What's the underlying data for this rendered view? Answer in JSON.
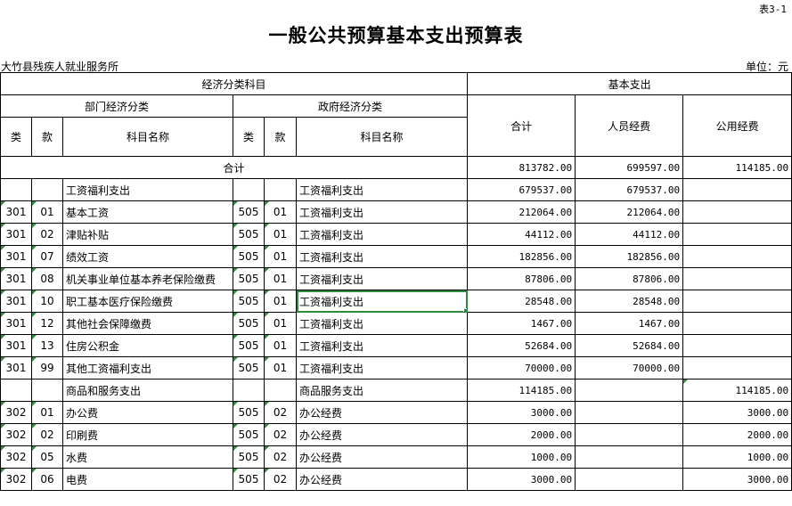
{
  "table_no": "表3-1",
  "title": "一般公共预算基本支出预算表",
  "org": "大竹县残疾人就业服务所",
  "unit": "单位：元",
  "headers": {
    "econ_class": "经济分类科目",
    "basic_exp": "基本支出",
    "dept_class": "部门经济分类",
    "gov_class": "政府经济分类",
    "total": "合计",
    "personnel": "人员经费",
    "public": "公用经费",
    "lei": "类",
    "kuan": "款",
    "name": "科目名称"
  },
  "summary": {
    "label": "合计",
    "total": "813782.00",
    "personnel": "699597.00",
    "public": "114185.00"
  },
  "rows": [
    {
      "dl": "",
      "dk": "",
      "dn": "工资福利支出",
      "gl": "",
      "gk": "",
      "gn": "工资福利支出",
      "total": "679537.00",
      "personnel": "679537.00",
      "public": ""
    },
    {
      "dl": "301",
      "dk": "01",
      "dn": "基本工资",
      "gl": "505",
      "gk": "01",
      "gn": "工资福利支出",
      "total": "212064.00",
      "personnel": "212064.00",
      "public": ""
    },
    {
      "dl": "301",
      "dk": "02",
      "dn": "津贴补贴",
      "gl": "505",
      "gk": "01",
      "gn": "工资福利支出",
      "total": "44112.00",
      "personnel": "44112.00",
      "public": ""
    },
    {
      "dl": "301",
      "dk": "07",
      "dn": "绩效工资",
      "gl": "505",
      "gk": "01",
      "gn": "工资福利支出",
      "total": "182856.00",
      "personnel": "182856.00",
      "public": ""
    },
    {
      "dl": "301",
      "dk": "08",
      "dn": "机关事业单位基本养老保险缴费",
      "gl": "505",
      "gk": "01",
      "gn": "工资福利支出",
      "total": "87806.00",
      "personnel": "87806.00",
      "public": ""
    },
    {
      "dl": "301",
      "dk": "10",
      "dn": "职工基本医疗保险缴费",
      "gl": "505",
      "gk": "01",
      "gn": "工资福利支出",
      "total": "28548.00",
      "personnel": "28548.00",
      "public": ""
    },
    {
      "dl": "301",
      "dk": "12",
      "dn": "其他社会保障缴费",
      "gl": "505",
      "gk": "01",
      "gn": "工资福利支出",
      "total": "1467.00",
      "personnel": "1467.00",
      "public": ""
    },
    {
      "dl": "301",
      "dk": "13",
      "dn": "住房公积金",
      "gl": "505",
      "gk": "01",
      "gn": "工资福利支出",
      "total": "52684.00",
      "personnel": "52684.00",
      "public": ""
    },
    {
      "dl": "301",
      "dk": "99",
      "dn": "其他工资福利支出",
      "gl": "505",
      "gk": "01",
      "gn": "工资福利支出",
      "total": "70000.00",
      "personnel": "70000.00",
      "public": ""
    },
    {
      "dl": "",
      "dk": "",
      "dn": "商品和服务支出",
      "gl": "",
      "gk": "",
      "gn": "商品服务支出",
      "total": "114185.00",
      "personnel": "",
      "public": "114185.00"
    },
    {
      "dl": "302",
      "dk": "01",
      "dn": "办公费",
      "gl": "505",
      "gk": "02",
      "gn": "办公经费",
      "total": "3000.00",
      "personnel": "",
      "public": "3000.00"
    },
    {
      "dl": "302",
      "dk": "02",
      "dn": "印刷费",
      "gl": "505",
      "gk": "02",
      "gn": "办公经费",
      "total": "2000.00",
      "personnel": "",
      "public": "2000.00"
    },
    {
      "dl": "302",
      "dk": "05",
      "dn": "水费",
      "gl": "505",
      "gk": "02",
      "gn": "办公经费",
      "total": "1000.00",
      "personnel": "",
      "public": "1000.00"
    },
    {
      "dl": "302",
      "dk": "06",
      "dn": "电费",
      "gl": "505",
      "gk": "02",
      "gn": "办公经费",
      "total": "3000.00",
      "personnel": "",
      "public": "3000.00"
    }
  ]
}
